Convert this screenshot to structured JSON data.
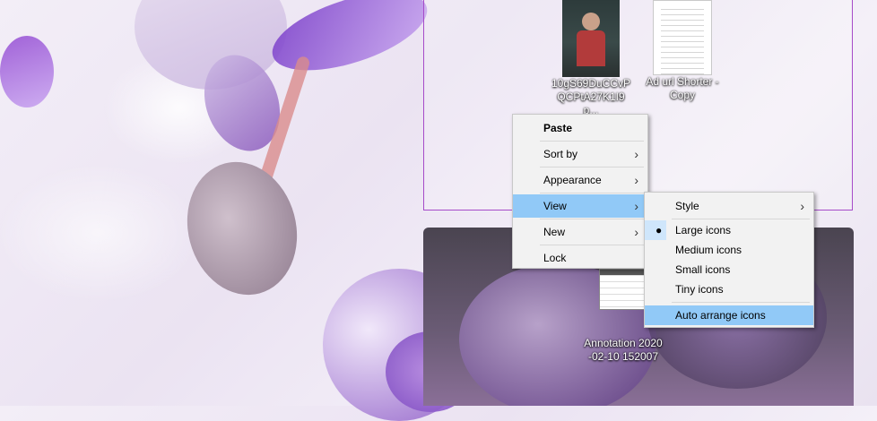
{
  "desktop": {
    "icons": [
      {
        "label_line1": "10gS69DuCCvP",
        "label_line2": "QCPtA27K1I9p..."
      },
      {
        "label_line1": "Ad url Shorter -",
        "label_line2": "Copy"
      },
      {
        "label_line1": "Annotation 2020",
        "label_line2": "-02-10 152007"
      }
    ]
  },
  "context_menu": {
    "items": [
      {
        "label": "Paste"
      },
      {
        "label": "Sort by",
        "arrow": "›"
      },
      {
        "label": "Appearance",
        "arrow": "›"
      },
      {
        "label": "View",
        "arrow": "›"
      },
      {
        "label": "New",
        "arrow": "›"
      },
      {
        "label": "Lock"
      }
    ]
  },
  "view_submenu": {
    "items": [
      {
        "label": "Style",
        "arrow": "›"
      },
      {
        "label": "Large icons",
        "mark": "●"
      },
      {
        "label": "Medium icons"
      },
      {
        "label": "Small icons"
      },
      {
        "label": "Tiny icons"
      },
      {
        "label": "Auto arrange icons"
      }
    ]
  },
  "colors": {
    "highlight": "#91c9f7",
    "selection_border": "#a64bc9"
  }
}
